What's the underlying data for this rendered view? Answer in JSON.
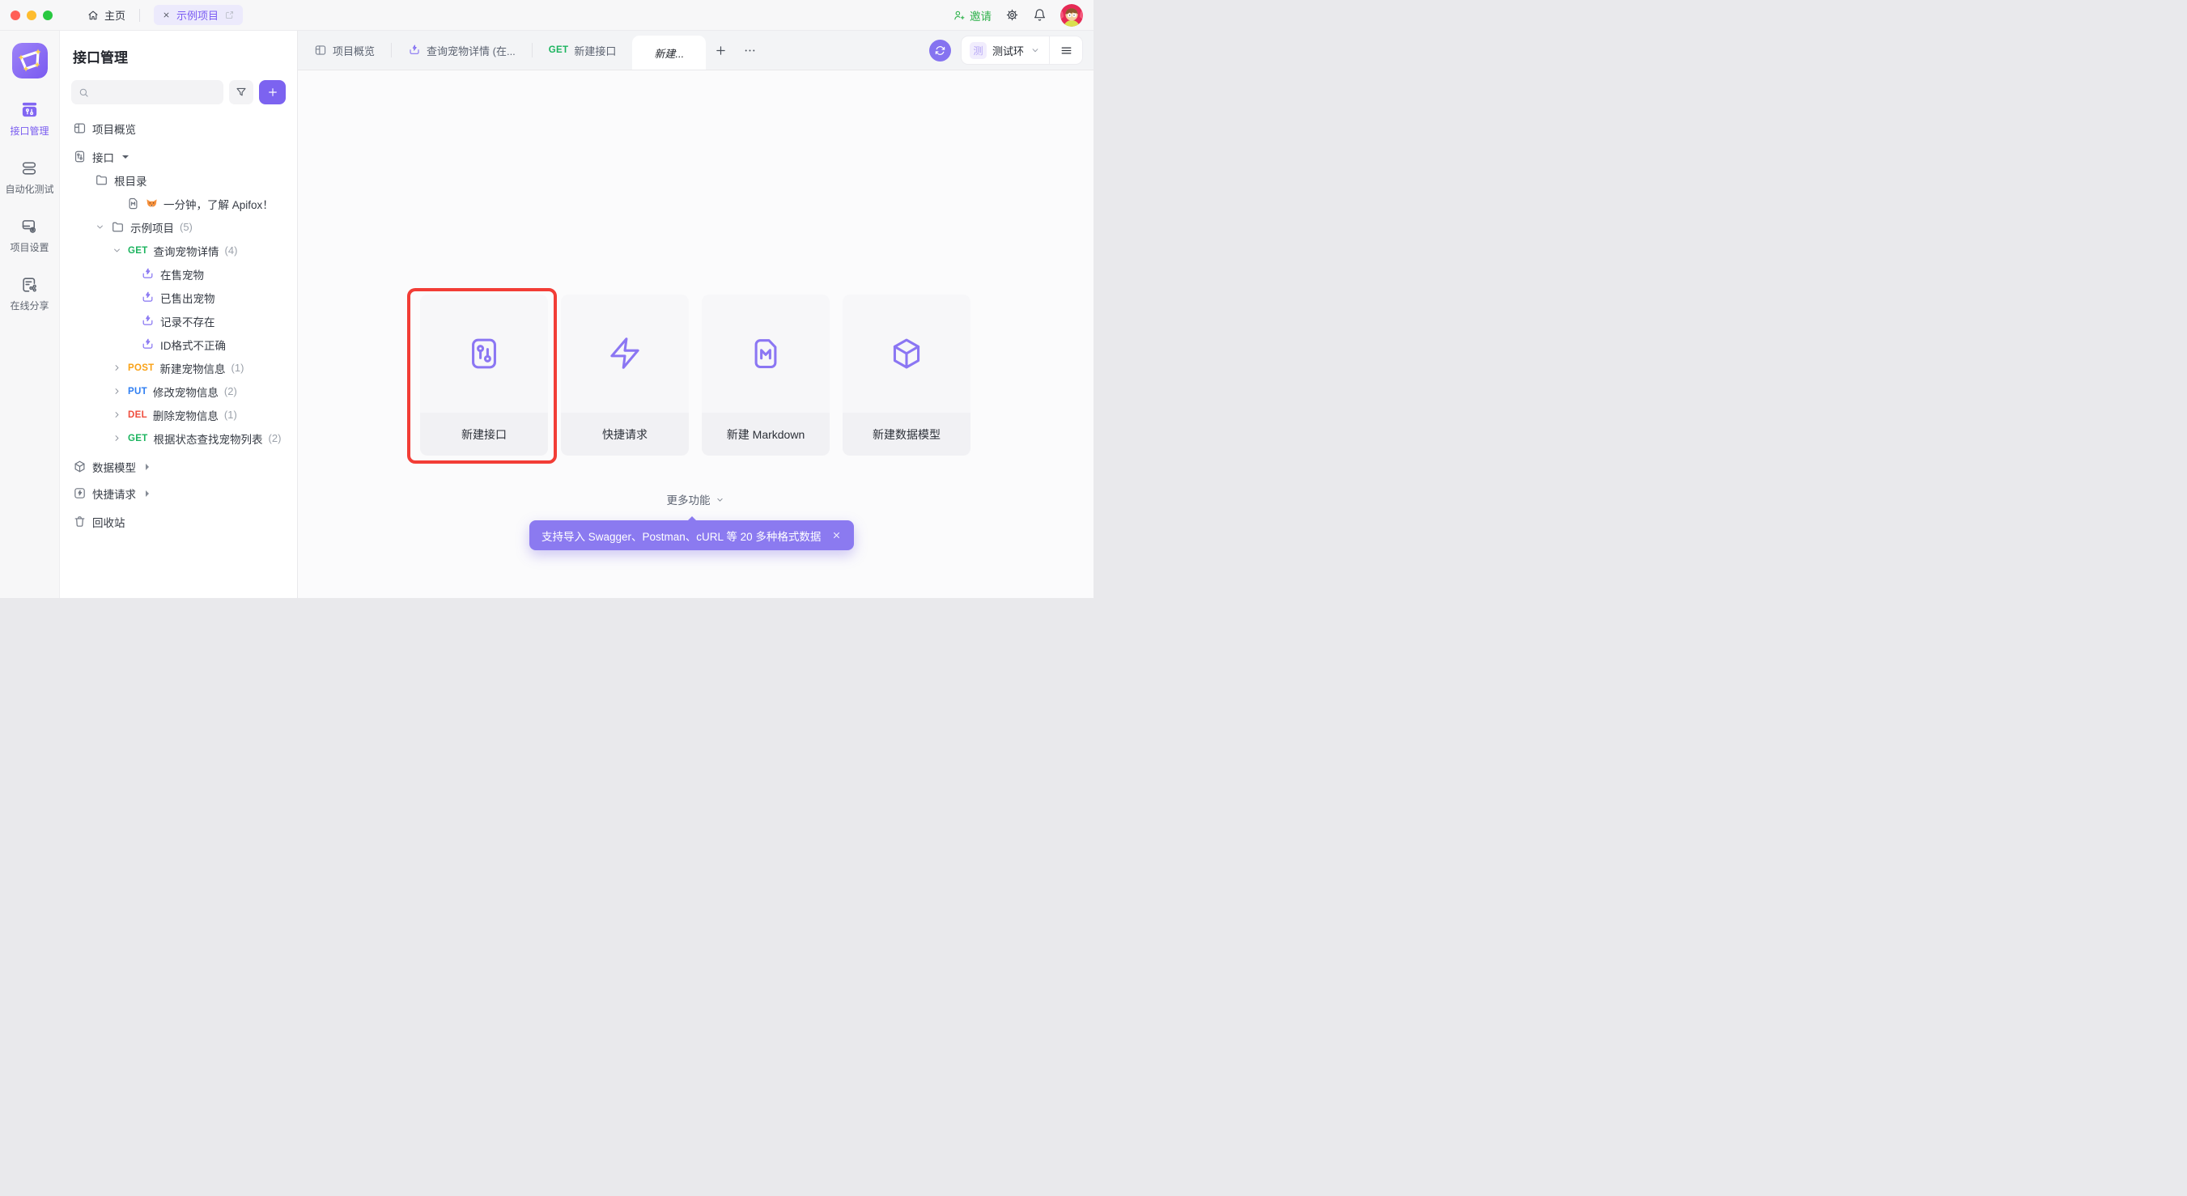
{
  "colors": {
    "accent": "#7c63f0",
    "accent_light": "#eceafc",
    "tooltip_bg": "#8b7af0",
    "highlight_red": "#f23d36",
    "method_get": "#1cb45f",
    "method_post": "#f9a115",
    "method_put": "#2e7ef2",
    "method_del": "#ef4e3e",
    "invite_green": "#2fb24c",
    "traffic_red": "#ff5f57",
    "traffic_yellow": "#febc2e",
    "traffic_green": "#28c840"
  },
  "icons": {
    "topbar": [
      "home-icon",
      "close-icon",
      "external-link-icon",
      "person-plus-icon",
      "gear-icon",
      "bell-icon",
      "avatar"
    ],
    "rail": [
      "app-logo-constellation",
      "api-management-icon",
      "automation-icon",
      "project-settings-icon",
      "share-icon"
    ],
    "panel": [
      "search-icon",
      "filter-funnel-icon",
      "plus-icon"
    ],
    "tree": [
      "layout-grid-icon",
      "api-pins-icon",
      "folder-icon",
      "markdown-icon",
      "fox-emoji",
      "case-bolt-tray-icon",
      "cube-icon",
      "quick-request-icon",
      "trash-icon",
      "caret-icons"
    ],
    "tabbar": [
      "layout-grid-icon",
      "case-bolt-tray-icon",
      "plus-icon",
      "more-dots-icon",
      "sync-refresh-icon",
      "chevron-down-icon",
      "hamburger-menu-icon"
    ],
    "cards": [
      "api-pins-icon",
      "lightning-bolt-icon",
      "markdown-doc-icon",
      "cube-icon"
    ],
    "tooltip": [
      "close-icon"
    ]
  },
  "topbar": {
    "home_label": "主页",
    "project_tab_label": "示例项目",
    "invite_label": "邀请"
  },
  "rail": {
    "items": [
      {
        "label": "接口管理",
        "active": true
      },
      {
        "label": "自动化测试",
        "active": false
      },
      {
        "label": "项目设置",
        "active": false
      },
      {
        "label": "在线分享",
        "active": false
      }
    ]
  },
  "panel": {
    "title": "接口管理",
    "search": {
      "value": "",
      "placeholder": ""
    }
  },
  "tree": {
    "items": [
      {
        "label": "项目概览",
        "icon": "layout-grid-icon"
      },
      {
        "label": "接口",
        "icon": "api-pins-icon",
        "caret": "down-solid"
      },
      {
        "label": "根目录",
        "icon": "folder-icon"
      },
      {
        "label": "一分钟，了解 Apifox！",
        "icon": "markdown-icon",
        "emoji": "🦊"
      },
      {
        "label": "示例项目",
        "count": "(5)",
        "icon": "folder-icon",
        "caret": "expanded"
      },
      {
        "label": "查询宠物详情",
        "count": "(4)",
        "method": "GET",
        "caret": "expanded"
      },
      {
        "label": "在售宠物",
        "icon": "case-bolt-tray-icon"
      },
      {
        "label": "已售出宠物",
        "icon": "case-bolt-tray-icon"
      },
      {
        "label": "记录不存在",
        "icon": "case-bolt-tray-icon"
      },
      {
        "label": "ID格式不正确",
        "icon": "case-bolt-tray-icon"
      },
      {
        "label": "新建宠物信息",
        "count": "(1)",
        "method": "POST",
        "caret": "collapsed"
      },
      {
        "label": "修改宠物信息",
        "count": "(2)",
        "method": "PUT",
        "caret": "collapsed"
      },
      {
        "label": "删除宠物信息",
        "count": "(1)",
        "method": "DEL",
        "caret": "collapsed"
      },
      {
        "label": "根据状态查找宠物列表",
        "count": "(2)",
        "method": "GET",
        "caret": "collapsed"
      },
      {
        "label": "数据模型",
        "icon": "cube-icon",
        "caret": "right-solid"
      },
      {
        "label": "快捷请求",
        "icon": "quick-request-icon",
        "caret": "right-solid"
      },
      {
        "label": "回收站",
        "icon": "trash-icon"
      }
    ]
  },
  "tabbar": {
    "tabs": [
      {
        "label": "项目概览",
        "icon": "layout-grid-icon",
        "active": false
      },
      {
        "label": "查询宠物详情 (在...",
        "icon": "case-bolt-tray-icon",
        "active": false
      },
      {
        "label": "新建接口",
        "method": "GET",
        "active": false
      },
      {
        "label": "新建...",
        "active": true
      }
    ],
    "env": {
      "badge": "测",
      "name": "测试环"
    }
  },
  "main": {
    "cards": [
      {
        "label": "新建接口",
        "icon": "api-pins-icon",
        "highlighted": true
      },
      {
        "label": "快捷请求",
        "icon": "lightning-bolt-icon",
        "highlighted": false
      },
      {
        "label": "新建 Markdown",
        "icon": "markdown-doc-icon",
        "highlighted": false
      },
      {
        "label": "新建数据模型",
        "icon": "cube-icon",
        "highlighted": false
      }
    ],
    "more_label": "更多功能",
    "tooltip": {
      "text": "支持导入 Swagger、Postman、cURL 等 20 多种格式数据",
      "close": "×"
    }
  }
}
